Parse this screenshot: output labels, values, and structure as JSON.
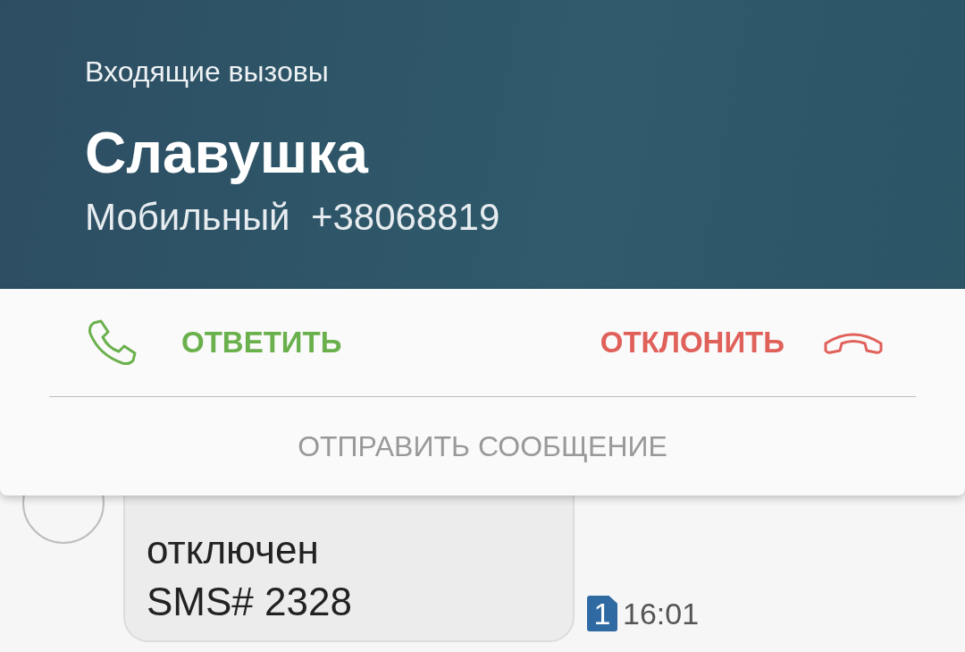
{
  "notification": {
    "title": "Входящие вызовы",
    "caller": "Славушка",
    "number_line": "Мобильный  +38068819",
    "actions": [
      {
        "kind": "answer",
        "label": "ОТВЕТИТЬ"
      },
      {
        "kind": "decline",
        "label": "ОТКЛОНИТЬ"
      }
    ],
    "send_message": "ОТПРАВИТЬ СООБЩЕНИЕ"
  },
  "conversation": {
    "message": {
      "text": "отключен\nSMS# 2328",
      "sim": "1",
      "time": "16:01"
    }
  }
}
